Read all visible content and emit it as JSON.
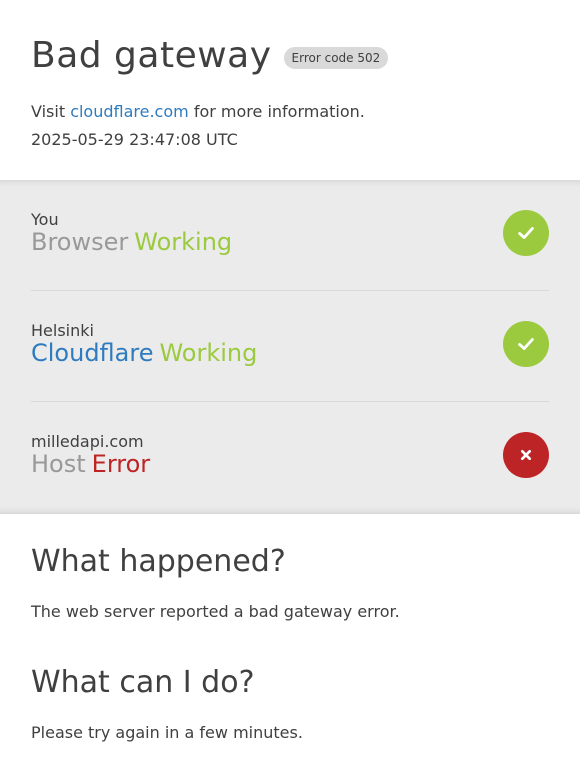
{
  "header": {
    "title": "Bad gateway",
    "error_badge": "Error code 502",
    "visit_prefix": "Visit",
    "visit_link": "cloudflare.com",
    "visit_suffix": "for more information.",
    "timestamp": "2025-05-29 23:47:08 UTC"
  },
  "statuses": [
    {
      "location": "You",
      "name": "Browser",
      "status": "Working",
      "name_color": "#999999",
      "status_color": "#9bca3e",
      "icon": "check-icon",
      "icon_bg": "#9bca3e"
    },
    {
      "location": "Helsinki",
      "name": "Cloudflare",
      "status": "Working",
      "name_color": "#2f7bbf",
      "status_color": "#9bca3e",
      "icon": "check-icon",
      "icon_bg": "#9bca3e"
    },
    {
      "location": "milledapi.com",
      "name": "Host",
      "status": "Error",
      "name_color": "#999999",
      "status_color": "#bd2426",
      "icon": "x-icon",
      "icon_bg": "#bd2426"
    }
  ],
  "what_happened": {
    "heading": "What happened?",
    "text": "The web server reported a bad gateway error."
  },
  "what_can_i_do": {
    "heading": "What can I do?",
    "text": "Please try again in a few minutes."
  }
}
